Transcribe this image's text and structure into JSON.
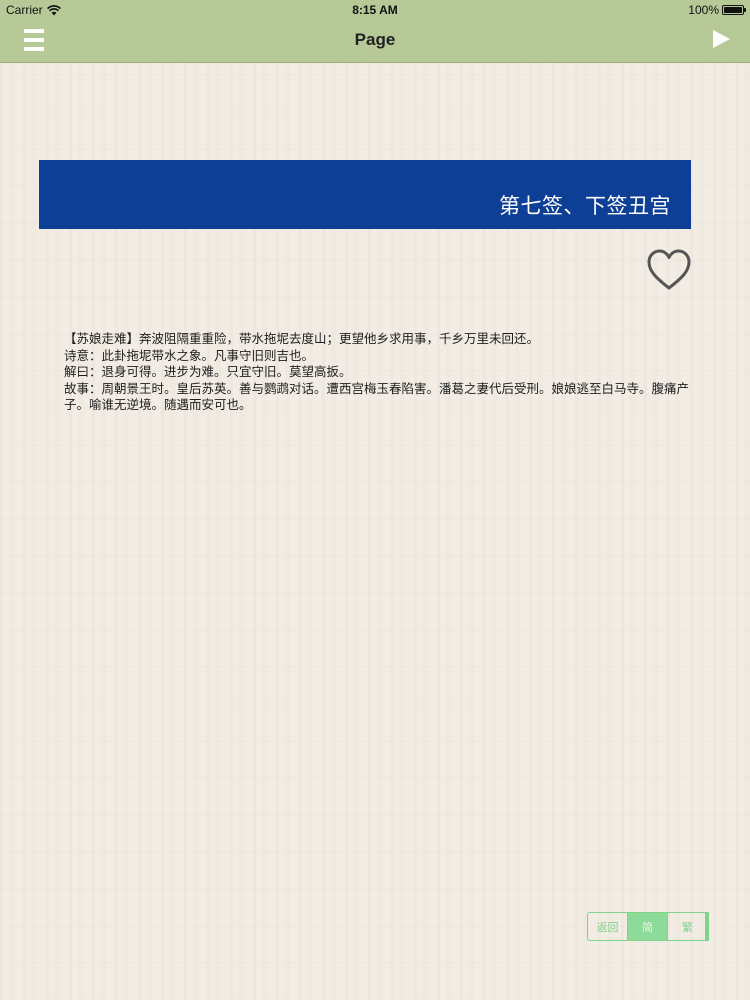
{
  "status_bar": {
    "carrier": "Carrier",
    "time": "8:15 AM",
    "battery": "100%"
  },
  "nav": {
    "title": "Page",
    "menu_icon": "menu-icon",
    "play_icon": "play-icon"
  },
  "banner": {
    "title": "第七签、下签丑宫"
  },
  "favorite_icon": "heart-outline-icon",
  "content": {
    "lines": [
      "【苏娘走难】奔波阻隔重重险，带水拖坭去度山；更望他乡求用事，千乡万里未回还。",
      "诗意：此卦拖坭带水之象。凡事守旧则吉也。",
      "解曰：退身可得。进步为难。只宜守旧。莫望高扳。",
      "故事：周朝景王时。皇后苏英。善与鹦鹉对话。遭西宫梅玉春陷害。潘葛之妻代后受刑。娘娘逃至白马寺。腹痛产子。喻谁无逆境。随遇而安可也。"
    ]
  },
  "segmented_control": {
    "options": [
      "返回",
      "简",
      "繁"
    ],
    "selected_index": 1
  },
  "colors": {
    "nav_bar": "#b7c996",
    "banner": "#0d3f96",
    "segment_accent": "#7fd48a",
    "background": "#f2ece3"
  }
}
